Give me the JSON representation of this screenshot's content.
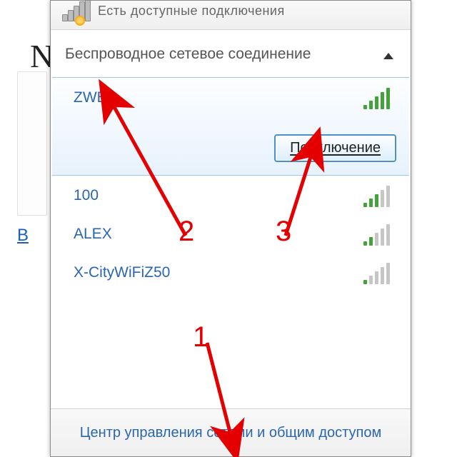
{
  "top_status": "Есть доступные подключения",
  "wireless_header": "Беспроводное сетевое соединение",
  "networks": [
    {
      "name": "ZWER",
      "signal": 5,
      "selected": true
    },
    {
      "name": "100",
      "signal": 3,
      "selected": false
    },
    {
      "name": "ALEX",
      "signal": 2,
      "selected": false
    },
    {
      "name": "X-CityWiFiZ50",
      "signal": 1,
      "selected": false
    }
  ],
  "connect_label": "Подключение",
  "footer_link": "Центр управления сетями и общим доступом",
  "annotation": {
    "n1": "1",
    "n2": "2",
    "n3": "3"
  }
}
